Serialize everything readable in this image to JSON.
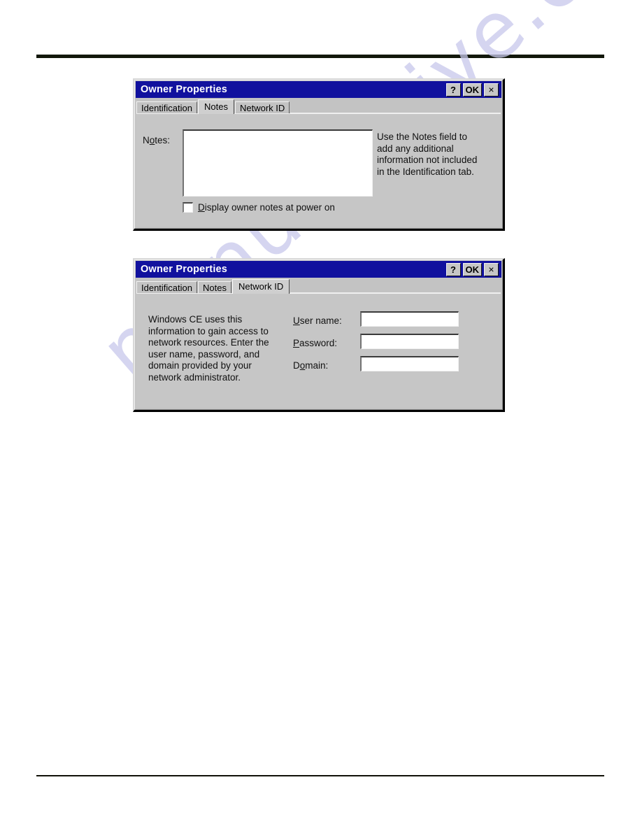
{
  "page": {
    "watermark": "manualshive.com",
    "rule_color": "#12180a"
  },
  "dialogs": [
    {
      "id": "owner-properties-notes",
      "title": "Owner Properties",
      "titlebar_color": "#11119e",
      "buttons": [
        {
          "name": "help",
          "label": "?"
        },
        {
          "name": "ok",
          "label": "OK"
        },
        {
          "name": "close",
          "label": "×"
        }
      ],
      "tabs": [
        {
          "label": "Identification",
          "selected": false
        },
        {
          "label": "Notes",
          "selected": true
        },
        {
          "label": "Network ID",
          "selected": false
        }
      ],
      "notes_tab": {
        "notes_label_pre": "N",
        "notes_label_accel": "o",
        "notes_label_post": "tes:",
        "notes_value": "",
        "help_text": "Use the Notes field to\nadd any additional\ninformation not included\nin the Identification tab.",
        "checkbox_pre": "",
        "checkbox_accel": "D",
        "checkbox_post": "isplay owner notes at power on",
        "checkbox_checked": false
      }
    },
    {
      "id": "owner-properties-network-id",
      "title": "Owner Properties",
      "titlebar_color": "#11119e",
      "buttons": [
        {
          "name": "help",
          "label": "?"
        },
        {
          "name": "ok",
          "label": "OK"
        },
        {
          "name": "close",
          "label": "×"
        }
      ],
      "tabs": [
        {
          "label": "Identification",
          "selected": false
        },
        {
          "label": "Notes",
          "selected": false
        },
        {
          "label": "Network ID",
          "selected": true
        }
      ],
      "network_tab": {
        "description": "Windows CE uses this\ninformation to gain access to\nnetwork resources. Enter the\nuser name, password, and\ndomain provided by your\nnetwork administrator.",
        "fields": [
          {
            "name": "user-name",
            "label_pre": "",
            "label_accel": "U",
            "label_post": "ser name:",
            "value": ""
          },
          {
            "name": "password",
            "label_pre": "",
            "label_accel": "P",
            "label_post": "assword:",
            "value": ""
          },
          {
            "name": "domain",
            "label_pre": "D",
            "label_accel": "o",
            "label_post": "main:",
            "value": ""
          }
        ]
      }
    }
  ]
}
